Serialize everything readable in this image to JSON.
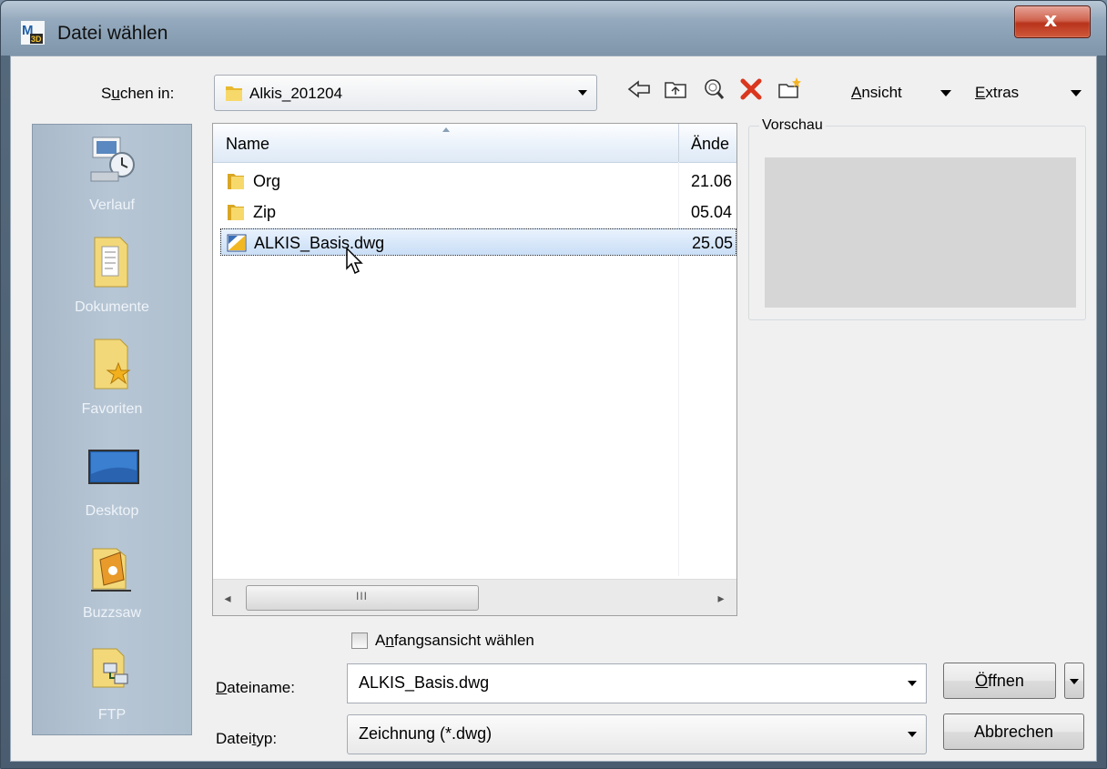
{
  "window": {
    "title": "Datei wählen",
    "close_glyph": "x",
    "app_icon": "autocad-map-3d-icon"
  },
  "toolbar": {
    "lookin_label_prefix": "S",
    "lookin_label_u": "u",
    "lookin_label_rest": "chen in:",
    "lookin_value": "Alkis_201204",
    "icons": [
      "back-icon",
      "up-folder-icon",
      "search-web-icon",
      "delete-icon",
      "new-folder-icon"
    ],
    "view_u": "A",
    "view_rest": "nsicht",
    "extras_u": "E",
    "extras_rest": "xtras"
  },
  "sidebar": {
    "items": [
      {
        "label": "Verlauf",
        "icon": "history-icon"
      },
      {
        "label": "Dokumente",
        "icon": "documents-icon"
      },
      {
        "label": "Favoriten",
        "icon": "favorites-icon"
      },
      {
        "label": "Desktop",
        "icon": "desktop-icon"
      },
      {
        "label": "Buzzsaw",
        "icon": "buzzsaw-icon"
      },
      {
        "label": "FTP",
        "icon": "ftp-icon"
      }
    ]
  },
  "filelist": {
    "columns": [
      "Name",
      "Ände"
    ],
    "rows": [
      {
        "name": "Org",
        "date": "21.06",
        "type": "folder"
      },
      {
        "name": "Zip",
        "date": "05.04",
        "type": "folder"
      },
      {
        "name": "ALKIS_Basis.dwg",
        "date": "25.05",
        "type": "dwg",
        "selected": true
      }
    ],
    "scroll_left": "◂",
    "scroll_right": "▸",
    "scroll_grip": "III"
  },
  "preview": {
    "label": "Vorschau"
  },
  "options": {
    "initial_view_u": "n",
    "initial_view_pre": "A",
    "initial_view_rest": "fangsansicht wählen",
    "initial_view_checked": false
  },
  "filename": {
    "label_u": "D",
    "label_rest": "ateiname:",
    "value": "ALKIS_Basis.dwg"
  },
  "filetype": {
    "label_pre": "Datei",
    "label_u": "t",
    "label_rest": "yp:",
    "value": "Zeichnung (*.dwg)"
  },
  "buttons": {
    "open_u": "Ö",
    "open_rest": "ffnen",
    "cancel": "Abbrechen"
  },
  "colors": {
    "selection": "#c9def6",
    "close_button": "#c7442b",
    "sidebar": "#b0c0cf"
  }
}
